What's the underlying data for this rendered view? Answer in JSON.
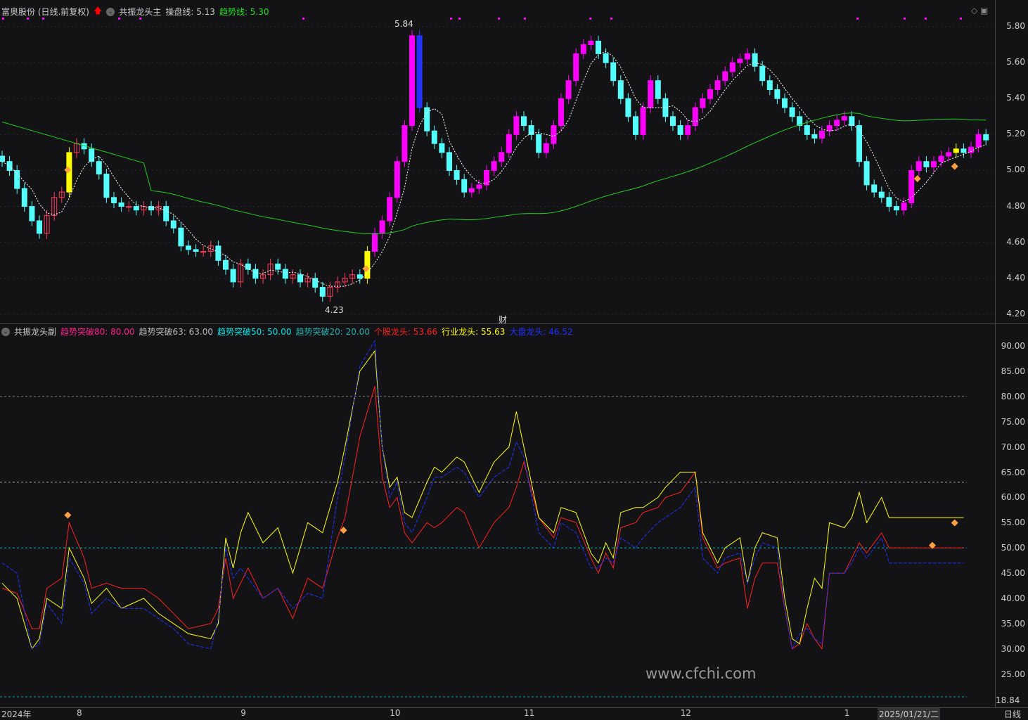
{
  "header": {
    "stock": "富奥股份 (日线.前复权)",
    "indicator": "共振龙头主",
    "line1_label": "操盘线: 5.13",
    "line2_label": "趋势线: 5.30"
  },
  "sub_header": {
    "indicator": "共振龙头副",
    "items": [
      {
        "text": "趋势突破80: 80.00",
        "color": "#ff1e8c"
      },
      {
        "text": "趋势突破63: 63.00",
        "color": "#bbbbbb"
      },
      {
        "text": "趋势突破50: 50.00",
        "color": "#00e5e5"
      },
      {
        "text": "趋势突破20: 20.00",
        "color": "#20b0b0"
      },
      {
        "text": "个股龙头: 53.66",
        "color": "#ff2020"
      },
      {
        "text": "行业龙头: 55.63",
        "color": "#ffff00"
      },
      {
        "text": "大盘龙头: 46.52",
        "color": "#2030ff"
      }
    ]
  },
  "price_axis": [
    "5.80",
    "5.60",
    "5.40",
    "5.20",
    "5.00",
    "4.80",
    "4.60",
    "4.40",
    "4.20"
  ],
  "sub_axis": [
    "90.00",
    "85.00",
    "80.00",
    "75.00",
    "70.00",
    "65.00",
    "60.00",
    "55.00",
    "50.00",
    "45.00",
    "40.00",
    "35.00",
    "30.00",
    "25.00"
  ],
  "sub_axis_low": "18.84",
  "annotations": {
    "high": "5.84",
    "low": "4.23",
    "cai": "财"
  },
  "x_labels": [
    {
      "t": "2024年",
      "i": 0
    },
    {
      "t": "8",
      "i": 10
    },
    {
      "t": "9",
      "i": 32
    },
    {
      "t": "10",
      "i": 52
    },
    {
      "t": "11",
      "i": 70
    },
    {
      "t": "12",
      "i": 91
    },
    {
      "t": "1",
      "i": 113
    }
  ],
  "cursor_date": "2025/01/21/二",
  "period": "日线",
  "watermark": "www.cfchi.com",
  "colors": {
    "up": "#ff00ff",
    "down": "#54ffff",
    "ma": "#22cc22",
    "yellow": "#ffff00"
  },
  "closes": [
    5.05,
    5.0,
    4.9,
    4.8,
    4.72,
    4.65,
    4.75,
    4.85,
    4.88,
    5.1,
    5.15,
    5.12,
    5.05,
    4.98,
    4.85,
    4.82,
    4.8,
    4.8,
    4.78,
    4.8,
    4.78,
    4.8,
    4.72,
    4.68,
    4.58,
    4.56,
    4.55,
    4.55,
    4.58,
    4.5,
    4.45,
    4.38,
    4.48,
    4.45,
    4.4,
    4.42,
    4.48,
    4.45,
    4.4,
    4.42,
    4.38,
    4.4,
    4.35,
    4.3,
    4.35,
    4.38,
    4.4,
    4.42,
    4.4,
    4.55,
    4.65,
    4.72,
    4.85,
    5.05,
    5.25,
    5.75,
    5.35,
    5.22,
    5.15,
    5.1,
    5.0,
    4.95,
    4.88,
    4.9,
    4.92,
    5.0,
    5.05,
    5.1,
    5.2,
    5.3,
    5.25,
    5.2,
    5.1,
    5.15,
    5.25,
    5.4,
    5.5,
    5.65,
    5.7,
    5.72,
    5.65,
    5.6,
    5.5,
    5.4,
    5.3,
    5.2,
    5.35,
    5.5,
    5.4,
    5.3,
    5.25,
    5.2,
    5.25,
    5.35,
    5.4,
    5.45,
    5.5,
    5.55,
    5.6,
    5.62,
    5.65,
    5.58,
    5.5,
    5.45,
    5.4,
    5.35,
    5.3,
    5.25,
    5.2,
    5.18,
    5.22,
    5.25,
    5.28,
    5.3,
    5.25,
    5.05,
    4.92,
    4.88,
    4.85,
    4.8,
    4.78,
    4.82,
    5.0,
    5.05,
    5.02,
    5.05,
    5.08,
    5.1,
    5.12,
    5.1,
    5.13,
    5.2,
    5.17
  ],
  "ind": {
    "idx": [
      0,
      2,
      4,
      5,
      6,
      8,
      9,
      11,
      12,
      14,
      16,
      19,
      21,
      23,
      25,
      28,
      29,
      30,
      31,
      32,
      33,
      35,
      37,
      39,
      41,
      43,
      45,
      46,
      48,
      50,
      51,
      52,
      53,
      54,
      55,
      57,
      58,
      59,
      61,
      62,
      64,
      66,
      68,
      69,
      70,
      72,
      74,
      75,
      77,
      79,
      80,
      81,
      82,
      83,
      85,
      86,
      88,
      89,
      91,
      93,
      94,
      96,
      97,
      99,
      100,
      101,
      102,
      104,
      105,
      106,
      107,
      108,
      109,
      110,
      111,
      113,
      114,
      115,
      116,
      118,
      119,
      120,
      122,
      124,
      125,
      126,
      127,
      128,
      129
    ],
    "yellow": [
      43,
      40,
      30,
      32,
      40,
      38,
      50,
      44,
      39,
      42,
      38,
      40,
      37,
      35,
      33,
      32,
      35,
      52,
      46,
      53,
      57,
      51,
      54,
      45,
      55,
      53,
      63,
      70,
      85,
      89,
      70,
      62,
      64,
      57,
      56,
      63,
      66,
      65,
      68,
      67,
      61,
      67,
      70,
      77,
      70,
      56,
      53,
      58,
      57,
      49,
      47,
      51,
      48,
      57,
      58,
      58,
      60,
      62,
      65,
      65,
      53,
      47,
      50,
      52,
      43,
      50,
      53,
      52,
      40,
      32,
      31,
      38,
      44,
      42,
      55,
      54,
      56,
      61,
      55,
      60,
      56,
      56,
      56,
      56,
      56,
      56,
      56,
      56,
      56
    ],
    "red": [
      42,
      41,
      34,
      34,
      42,
      44,
      55,
      48,
      42,
      43,
      42,
      42,
      40,
      37,
      34,
      35,
      38,
      48,
      40,
      43,
      46,
      40,
      42,
      36,
      44,
      42,
      52,
      56,
      72,
      82,
      64,
      58,
      60,
      53,
      51,
      55,
      54,
      55,
      58,
      57,
      50,
      55,
      58,
      62,
      67,
      56,
      52,
      56,
      55,
      48,
      45,
      49,
      46,
      54,
      55,
      57,
      58,
      60,
      61,
      65,
      52,
      46,
      47,
      48,
      38,
      44,
      47,
      47,
      38,
      30,
      31,
      35,
      32,
      30,
      45,
      45,
      48,
      51,
      49,
      53,
      50,
      50,
      50,
      50,
      50,
      50,
      50,
      50,
      50
    ],
    "blue": [
      47,
      45,
      30,
      31,
      39,
      35,
      48,
      43,
      37,
      40,
      38,
      38,
      36,
      34,
      31,
      30,
      36,
      50,
      44,
      46,
      44,
      40,
      42,
      38,
      41,
      40,
      60,
      68,
      86,
      91,
      70,
      60,
      63,
      55,
      53,
      60,
      64,
      64,
      66,
      65,
      60,
      64,
      66,
      71,
      68,
      53,
      50,
      55,
      53,
      46,
      46,
      48,
      47,
      52,
      50,
      52,
      55,
      56,
      58,
      62,
      48,
      45,
      48,
      49,
      43,
      48,
      51,
      50,
      38,
      30,
      33,
      34,
      32,
      31,
      45,
      45,
      47,
      50,
      48,
      52,
      47,
      47,
      47,
      47,
      47,
      47,
      47,
      47,
      47
    ]
  }
}
